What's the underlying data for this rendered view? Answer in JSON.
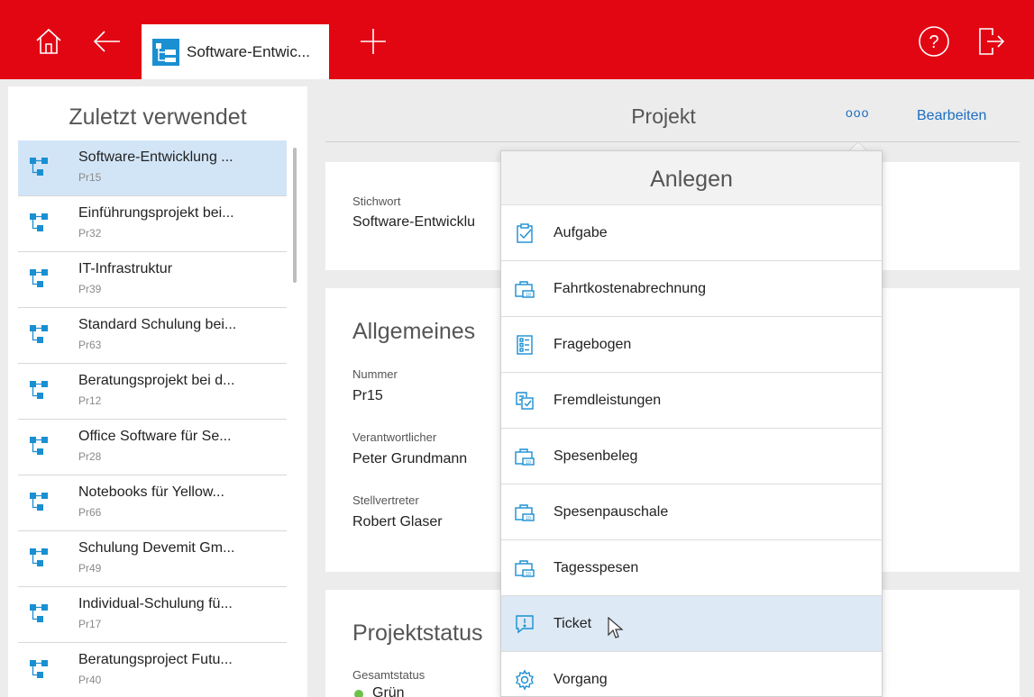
{
  "topbar": {
    "tab_label": "Software-Entwic...",
    "icons": [
      "home-icon",
      "back-arrow-icon",
      "project-tree-icon",
      "plus-icon",
      "help-icon",
      "logout-icon"
    ],
    "help_glyph": "?"
  },
  "sidebar": {
    "title": "Zuletzt verwendet",
    "items": [
      {
        "title": "Software-Entwicklung ...",
        "code": "Pr15"
      },
      {
        "title": "Einführungsprojekt bei...",
        "code": "Pr32"
      },
      {
        "title": "IT-Infrastruktur",
        "code": "Pr39"
      },
      {
        "title": "Standard Schulung bei...",
        "code": "Pr63"
      },
      {
        "title": "Beratungsprojekt bei d...",
        "code": "Pr12"
      },
      {
        "title": "Office Software für Se...",
        "code": "Pr28"
      },
      {
        "title": "Notebooks für Yellow...",
        "code": "Pr66"
      },
      {
        "title": "Schulung Devemit Gm...",
        "code": "Pr49"
      },
      {
        "title": "Individual-Schulung fü...",
        "code": "Pr17"
      },
      {
        "title": "Beratungsproject Futu...",
        "code": "Pr40"
      }
    ]
  },
  "main": {
    "title": "Projekt",
    "dots": "ooo",
    "edit_label": "Bearbeiten",
    "stichwort_label": "Stichwort",
    "stichwort_value": "Software-Entwicklu",
    "allgemeines_title": "Allgemeines",
    "nummer_label": "Nummer",
    "nummer_value": "Pr15",
    "verantwortlicher_label": "Verantwortlicher",
    "verantwortlicher_value": "Peter Grundmann",
    "stellvertreter_label": "Stellvertreter",
    "stellvertreter_value": "Robert Glaser",
    "projektstatus_title": "Projektstatus",
    "gesamtstatus_label": "Gesamtstatus",
    "gesamtstatus_value": "Grün"
  },
  "dropdown": {
    "title": "Anlegen",
    "items": [
      {
        "label": "Aufgabe",
        "icon": "task-clipboard-icon"
      },
      {
        "label": "Fahrtkostenabrechnung",
        "icon": "expense-case-icon"
      },
      {
        "label": "Fragebogen",
        "icon": "questionnaire-icon"
      },
      {
        "label": "Fremdleistungen",
        "icon": "external-services-icon"
      },
      {
        "label": "Spesenbeleg",
        "icon": "expense-case-icon"
      },
      {
        "label": "Spesenpauschale",
        "icon": "expense-case-icon"
      },
      {
        "label": "Tagesspesen",
        "icon": "expense-case-icon"
      },
      {
        "label": "Ticket",
        "icon": "ticket-icon"
      },
      {
        "label": "Vorgang",
        "icon": "gear-icon"
      }
    ]
  },
  "colors": {
    "brand": "#e20613",
    "accent": "#1b6ec2",
    "selected": "#d2e5f7",
    "icon_blue": "#1a8fd2",
    "status_green": "#6ac24a"
  }
}
